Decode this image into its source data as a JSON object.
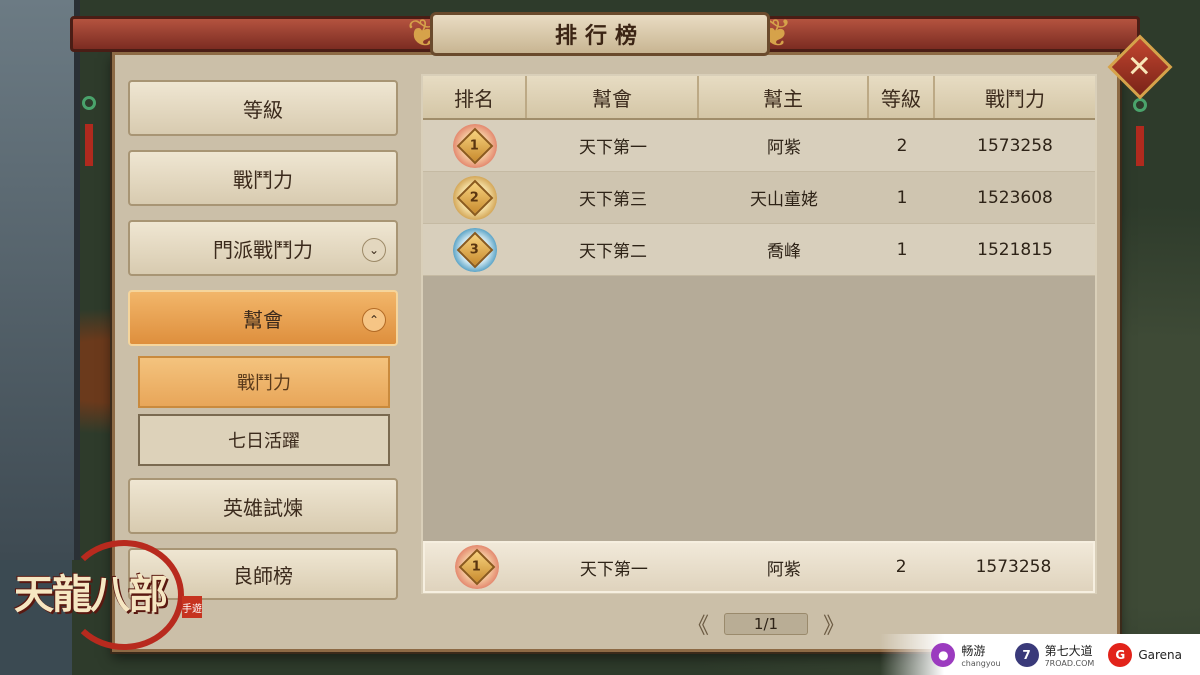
{
  "header": {
    "title": "排行榜"
  },
  "close": {
    "glyph": "✕"
  },
  "menu": {
    "items": [
      {
        "label": "等級",
        "active": false
      },
      {
        "label": "戰鬥力",
        "active": false
      },
      {
        "label": "門派戰鬥力",
        "active": false,
        "chevron": "⌄"
      },
      {
        "label": "幫會",
        "active": true,
        "chevron": "⌃"
      }
    ],
    "subitems": [
      {
        "label": "戰鬥力",
        "active": true
      },
      {
        "label": "七日活躍",
        "active": false
      }
    ],
    "more_items": [
      {
        "label": "英雄試煉"
      },
      {
        "label": "良師榜"
      }
    ]
  },
  "table": {
    "headers": [
      "排名",
      "幫會",
      "幫主",
      "等級",
      "戰鬥力"
    ],
    "rows": [
      {
        "rank": "1",
        "guild": "天下第一",
        "leader": "阿紫",
        "level": "2",
        "power": "1573258"
      },
      {
        "rank": "2",
        "guild": "天下第三",
        "leader": "天山童姥",
        "level": "1",
        "power": "1523608"
      },
      {
        "rank": "3",
        "guild": "天下第二",
        "leader": "喬峰",
        "level": "1",
        "power": "1521815"
      }
    ],
    "self_row": {
      "rank": "1",
      "guild": "天下第一",
      "leader": "阿紫",
      "level": "2",
      "power": "1573258"
    }
  },
  "pager": {
    "prev": "《",
    "page": "1/1",
    "next": "》"
  },
  "logo": {
    "text": "天龍八部",
    "stamp": "手遊"
  },
  "partners": [
    {
      "name": "畅游",
      "sub": "changyou",
      "color": "#9b3bbf",
      "icon": "●"
    },
    {
      "name": "第七大道",
      "sub": "7ROAD.COM",
      "color": "#3a3a7a",
      "icon": "7"
    },
    {
      "name": "Garena",
      "sub": "",
      "color": "#e2231a",
      "icon": "G"
    }
  ]
}
